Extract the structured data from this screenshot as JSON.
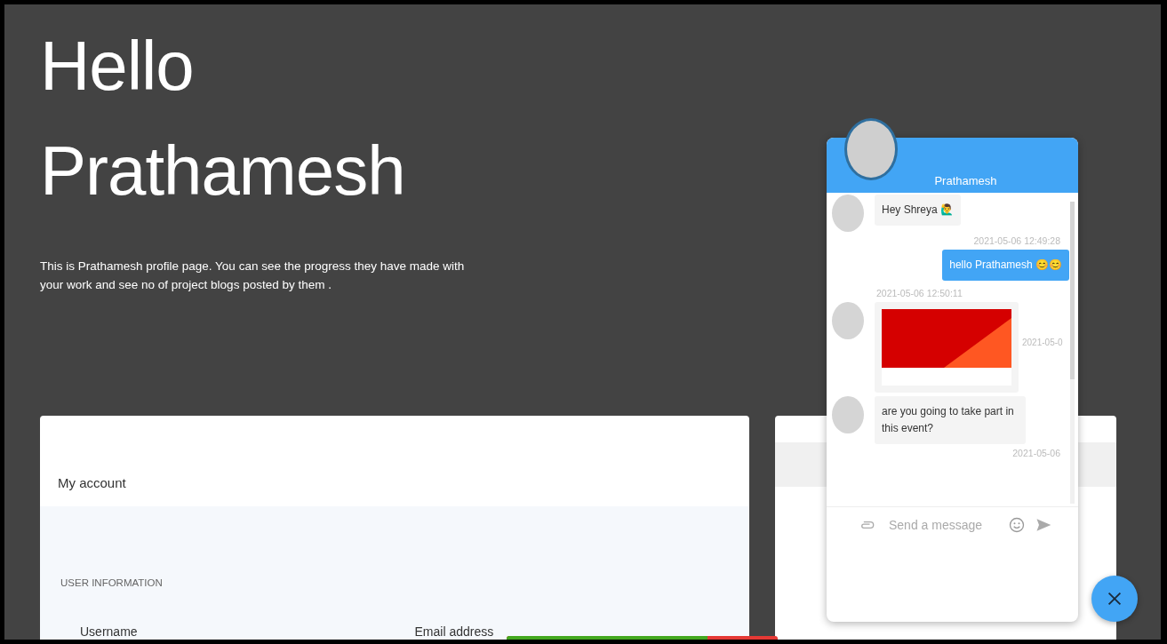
{
  "heading": [
    "Hello",
    "Prathamesh"
  ],
  "intro": "This is Prathamesh profile page. You can see the progress they have made with your work and see no of project blogs posted by them .",
  "account_card": {
    "title": "My account",
    "section": "USER INFORMATION",
    "fields": [
      "Username",
      "Email address"
    ]
  },
  "progress_bar": {
    "level": 0.74
  },
  "chat": {
    "contact": "Prathamesh",
    "messages": [
      {
        "kind": "text",
        "outgoing": false,
        "text": "Hey Shreya 🙋‍♂️",
        "time": "2021-05-06 12:49:28"
      },
      {
        "kind": "text",
        "outgoing": true,
        "text": "hello Prathamesh 😊😊",
        "time": "2021-05-06 12:50:11"
      },
      {
        "kind": "image",
        "outgoing": false,
        "time": "2021-05-0"
      },
      {
        "kind": "text",
        "outgoing": false,
        "text": "are you going to take part in this event?",
        "time": "2021-05-06"
      }
    ],
    "input": {
      "placeholder": "Send a message"
    }
  }
}
